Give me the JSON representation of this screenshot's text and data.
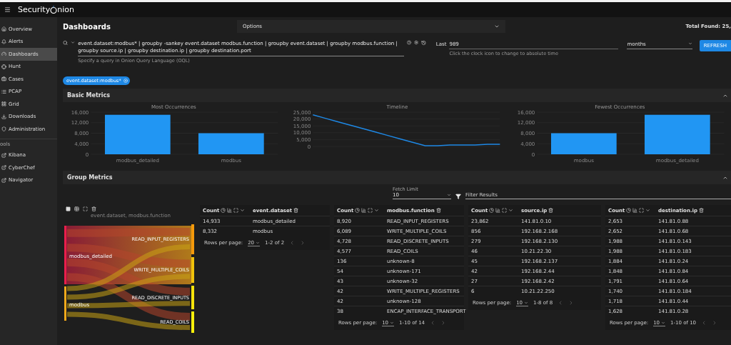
{
  "app": {
    "logo_left": "Security",
    "logo_right": "nion"
  },
  "sidebar": {
    "items": [
      {
        "label": "Overview",
        "selected": false
      },
      {
        "label": "Alerts",
        "selected": false
      },
      {
        "label": "Dashboards",
        "selected": true
      },
      {
        "label": "Hunt",
        "selected": false
      },
      {
        "label": "Cases",
        "selected": false
      },
      {
        "label": "PCAP",
        "selected": false
      },
      {
        "label": "Grid",
        "selected": false
      },
      {
        "label": "Downloads",
        "selected": false
      },
      {
        "label": "Administration",
        "selected": false
      }
    ],
    "tools_label": "ools",
    "tools": [
      {
        "label": "Kibana"
      },
      {
        "label": "CyberChef"
      },
      {
        "label": "Navigator"
      }
    ]
  },
  "page": {
    "title": "Dashboards",
    "options": "Options",
    "total_found": "Total Found: 25,"
  },
  "query": {
    "value": "event.dataset:modbus* | groupby -sankey event.dataset modbus.function | groupby event.dataset | groupby modbus.function | groupby source.ip | groupby destination.ip | groupby destination.port",
    "hint": "Specify a query in Onion Query Language (OQL)"
  },
  "time": {
    "label": "Last",
    "value": "989",
    "unit": "months",
    "hint": "Click the clock icon to change to absolute time",
    "refresh": "REFRESH"
  },
  "filters": [
    {
      "label": "event.dataset:modbus*"
    }
  ],
  "basic_metrics": {
    "title": "Basic Metrics",
    "charts": [
      {
        "chart_data": {
          "type": "bar",
          "title": "Most Occurrences",
          "grid": true,
          "categories": [
            "modbus_detailed",
            "modbus"
          ],
          "values": [
            15000,
            8000
          ],
          "ylim": [
            0,
            16000
          ],
          "yticks": [
            {
              "value": 0,
              "label": "0"
            },
            {
              "value": 4000,
              "label": "4,000"
            },
            {
              "value": 8000,
              "label": "8,000"
            },
            {
              "value": 12000,
              "label": "12,000"
            },
            {
              "value": 16000,
              "label": "16,000"
            }
          ]
        }
      },
      {
        "chart_data": {
          "type": "line",
          "title": "Timeline",
          "grid": true,
          "values": [
            23000,
            20500,
            18000,
            15500,
            13000,
            10500,
            8000,
            5500,
            3000,
            500,
            500,
            1000,
            1000,
            1000,
            1500,
            1500
          ],
          "ylim": [
            0,
            25000
          ],
          "yticks": [
            {
              "value": 0,
              "label": "0"
            },
            {
              "value": 5000,
              "label": "5,000"
            },
            {
              "value": 10000,
              "label": "10,000"
            },
            {
              "value": 15000,
              "label": "15,000"
            },
            {
              "value": 20000,
              "label": "20,000"
            },
            {
              "value": 25000,
              "label": "25,000"
            }
          ]
        }
      },
      {
        "chart_data": {
          "type": "bar",
          "title": "Fewest Occurrences",
          "grid": true,
          "categories": [
            "modbus",
            "modbus_detailed"
          ],
          "values": [
            8000,
            15000
          ],
          "ylim": [
            0,
            16000
          ],
          "yticks": [
            {
              "value": 0,
              "label": "0"
            },
            {
              "value": 4000,
              "label": "4,000"
            },
            {
              "value": 8000,
              "label": "8,000"
            },
            {
              "value": 12000,
              "label": "12,000"
            },
            {
              "value": 16000,
              "label": "16,000"
            }
          ]
        }
      }
    ]
  },
  "group_metrics": {
    "title": "Group Metrics",
    "fetch_limit_label": "Fetch Limit",
    "fetch_limit": "10",
    "filter_placeholder": "Filter Results",
    "sankey": {
      "title": "event.dataset, modbus.function",
      "sources": [
        "modbus_detailed",
        "modbus"
      ],
      "targets": [
        "READ_INPUT_REGISTERS",
        "WRITE_MULTIPLE_COILS",
        "READ_DISCRETE_INPUTS",
        "READ_COILS"
      ]
    },
    "tables": [
      {
        "columns": [
          "Count",
          "event.dataset"
        ],
        "rows_per_page_label": "Rows per page:",
        "rows_per_page": "20",
        "range": "1-2 of 2",
        "rows": [
          [
            "14,933",
            "modbus_detailed"
          ],
          [
            "8,332",
            "modbus"
          ]
        ]
      },
      {
        "columns": [
          "Count",
          "modbus.function"
        ],
        "rows_per_page_label": "Rows per page:",
        "rows_per_page": "10",
        "range": "1-10 of 14",
        "rows": [
          [
            "8,920",
            "READ_INPUT_REGISTERS"
          ],
          [
            "6,089",
            "WRITE_MULTIPLE_COILS"
          ],
          [
            "4,728",
            "READ_DISCRETE_INPUTS"
          ],
          [
            "4,577",
            "READ_COILS"
          ],
          [
            "136",
            "unknown-8"
          ],
          [
            "54",
            "unknown-171"
          ],
          [
            "43",
            "unknown-32"
          ],
          [
            "42",
            "WRITE_MULTIPLE_REGISTERS"
          ],
          [
            "42",
            "unknown-128"
          ],
          [
            "38",
            "ENCAP_INTERFACE_TRANSPORT"
          ]
        ]
      },
      {
        "columns": [
          "Count",
          "source.ip"
        ],
        "rows_per_page_label": "Rows per page:",
        "rows_per_page": "10",
        "range": "1-8 of 8",
        "rows": [
          [
            "23,862",
            "141.81.0.10"
          ],
          [
            "856",
            "192.168.2.168"
          ],
          [
            "279",
            "192.168.2.130"
          ],
          [
            "46",
            "10.21.22.30"
          ],
          [
            "45",
            "192.168.2.137"
          ],
          [
            "42",
            "192.168.2.44"
          ],
          [
            "27",
            "192.168.2.42"
          ],
          [
            "6",
            "10.21.22.250"
          ]
        ]
      },
      {
        "columns": [
          "Count",
          "destination.ip"
        ],
        "rows_per_page_label": "Rows per page:",
        "rows_per_page": "10",
        "range": "1-10 of 10",
        "rows": [
          [
            "2,653",
            "141.81.0.88"
          ],
          [
            "2,652",
            "141.81.0.68"
          ],
          [
            "1,988",
            "141.81.0.143"
          ],
          [
            "1,988",
            "141.81.0.183"
          ],
          [
            "1,884",
            "141.81.0.24"
          ],
          [
            "1,848",
            "141.81.0.84"
          ],
          [
            "1,791",
            "141.81.0.64"
          ],
          [
            "1,740",
            "141.81.0.184"
          ],
          [
            "1,718",
            "141.81.0.44"
          ],
          [
            "1,628",
            "141.81.0.28"
          ]
        ]
      }
    ]
  }
}
